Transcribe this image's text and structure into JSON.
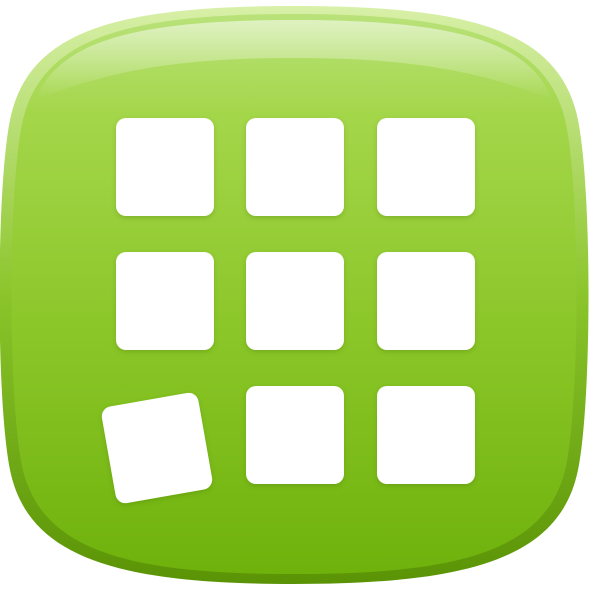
{
  "icon": {
    "semantic_name": "app-grid-icon",
    "colors": {
      "accent_top": "#b5e070",
      "accent_mid": "#98cf3a",
      "accent_bottom": "#6fb20c",
      "rim_dark": "#5e9a08",
      "tile": "#ffffff"
    },
    "grid": {
      "rows": 3,
      "columns": 3,
      "tiles_total": 9,
      "tilted_tile": "row-3-column-1"
    }
  }
}
